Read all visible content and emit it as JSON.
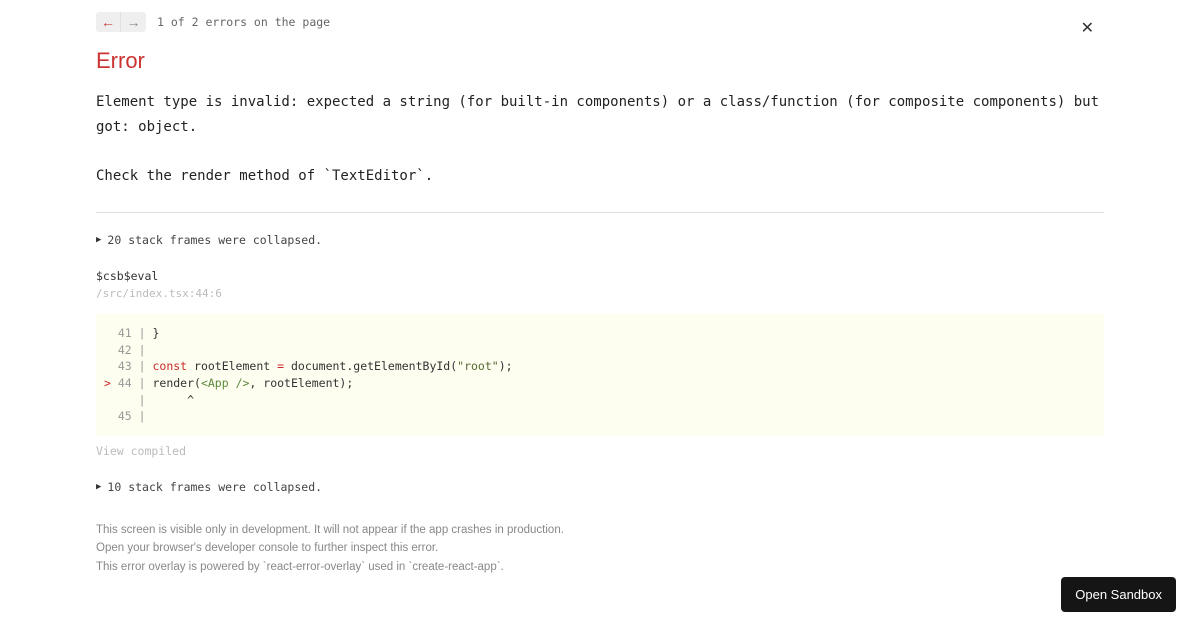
{
  "nav": {
    "counter": "1 of 2 errors on the page"
  },
  "title": "Error",
  "message": "Element type is invalid: expected a string (for built-in components) or a class/function (for composite components) but got: object.\n\nCheck the render method of `TextEditor`.",
  "collapse1": "20 stack frames were collapsed.",
  "frame": {
    "method": "$csb$eval",
    "location": "/src/index.tsx:44:6"
  },
  "code": {
    "line41_gutter": "  41 | ",
    "line41_body": "}",
    "line42_gutter": "  42 | ",
    "line42_body": "",
    "line43_gutter": "  43 | ",
    "line43_const": "const",
    "line43_mid": " rootElement ",
    "line43_eq": "=",
    "line43_after": " document.getElementById(",
    "line43_str": "\"root\"",
    "line43_end": ");",
    "line44_marker": ">",
    "line44_gutter": " 44 | ",
    "line44_render": "render(",
    "line44_jsx": "<App />",
    "line44_end": ", rootElement);",
    "line45_gutter": "     | ",
    "line45_caret": "     ^",
    "line46_gutter": "  45 | ",
    "line46_body": ""
  },
  "view_compiled": "View compiled",
  "collapse2": "10 stack frames were collapsed.",
  "footer": {
    "note1": "This screen is visible only in development. It will not appear if the app crashes in production.",
    "note2": "Open your browser's developer console to further inspect this error.",
    "note3": "This error overlay is powered by `react-error-overlay` used in `create-react-app`."
  },
  "sandbox_button": "Open Sandbox"
}
